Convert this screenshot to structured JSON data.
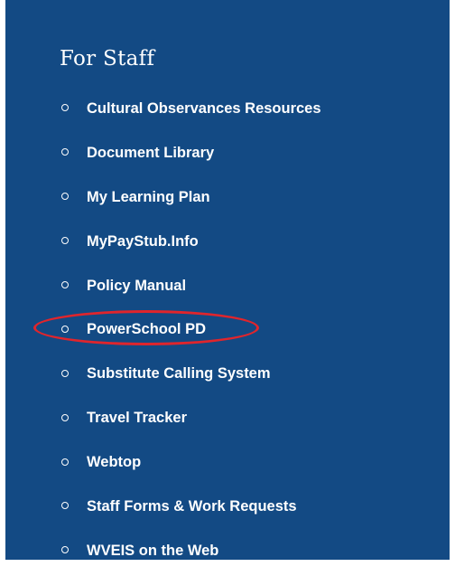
{
  "sidebar": {
    "title": "For Staff",
    "items": [
      {
        "label": "Cultural Observances Resources"
      },
      {
        "label": "Document Library"
      },
      {
        "label": "My Learning Plan"
      },
      {
        "label": "MyPayStub.Info"
      },
      {
        "label": "Policy Manual"
      },
      {
        "label": "PowerSchool PD",
        "highlighted": true
      },
      {
        "label": "Substitute Calling System"
      },
      {
        "label": "Travel Tracker"
      },
      {
        "label": "Webtop"
      },
      {
        "label": "Staff Forms & Work Requests"
      },
      {
        "label": "WVEIS on the Web"
      }
    ]
  },
  "colors": {
    "panel_background": "#134a84",
    "text": "#ffffff",
    "highlight_oval": "#e0252c"
  }
}
